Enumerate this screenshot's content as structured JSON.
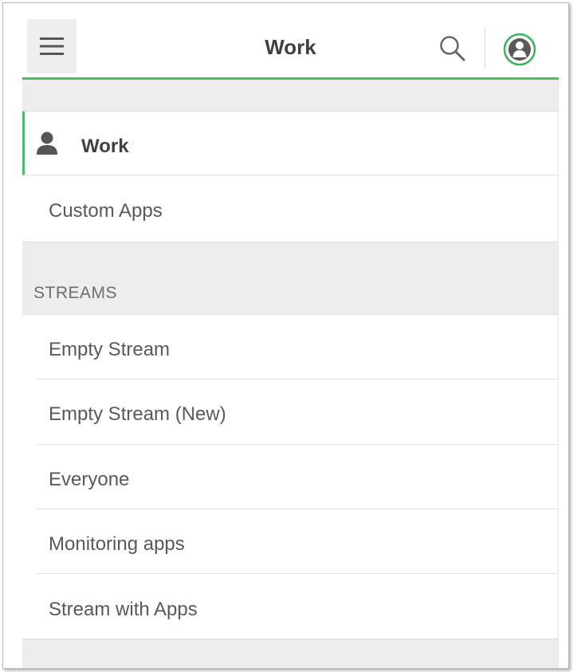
{
  "header": {
    "title": "Work",
    "menu_icon": "hamburger-icon",
    "search_icon": "search-icon",
    "profile_icon": "user-profile-icon",
    "accent_color": "#52b96a"
  },
  "nav": {
    "work_label": "Work",
    "work_icon": "person-icon",
    "custom_apps_label": "Custom Apps"
  },
  "streams": {
    "section_label": "STREAMS",
    "items": [
      {
        "label": "Empty Stream"
      },
      {
        "label": "Empty Stream (New)"
      },
      {
        "label": "Everyone"
      },
      {
        "label": "Monitoring apps"
      },
      {
        "label": "Stream with Apps"
      }
    ]
  }
}
